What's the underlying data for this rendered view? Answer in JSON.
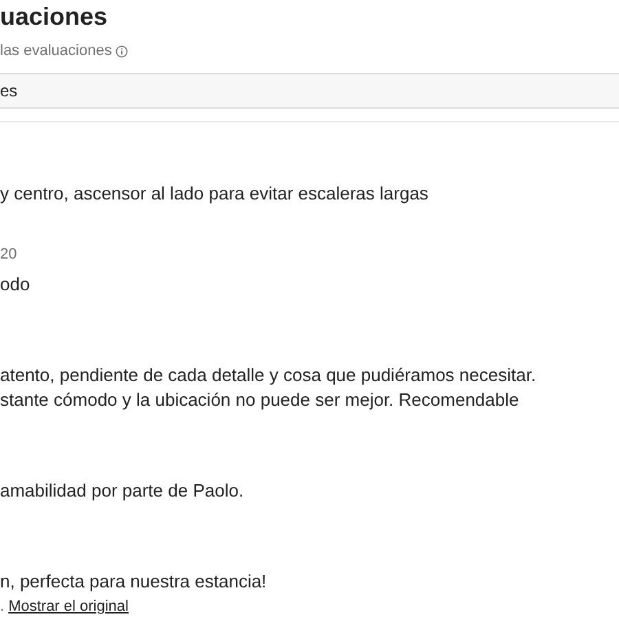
{
  "header": {
    "title": "uaciones",
    "subtitle": "las evaluaciones"
  },
  "search": {
    "value": "es"
  },
  "reviews": [
    {
      "lines": [
        "y centro, ascensor al lado para evitar escaleras largas"
      ]
    },
    {
      "date": "20",
      "lines": [
        "odo"
      ]
    },
    {
      "lines": [
        "atento, pendiente de cada detalle y cosa que pudiéramos necesitar.",
        "stante cómodo y la ubicación no puede ser mejor. Recomendable"
      ]
    },
    {
      "lines": [
        "amabilidad por parte de Paolo."
      ]
    },
    {
      "lines": [
        "n, perfecta para nuestra estancia!"
      ],
      "note": ".",
      "link": "Mostrar el original"
    }
  ]
}
